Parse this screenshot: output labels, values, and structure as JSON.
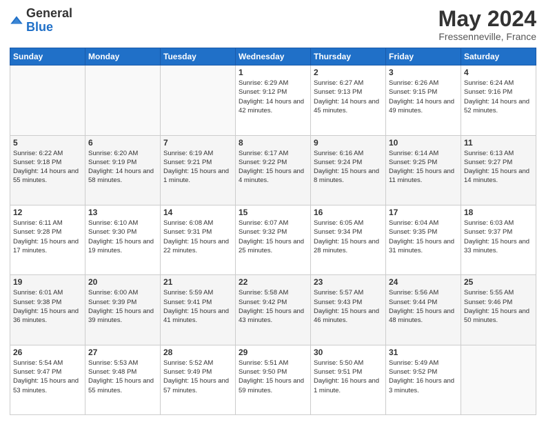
{
  "logo": {
    "general": "General",
    "blue": "Blue"
  },
  "header": {
    "month": "May 2024",
    "location": "Fressenneville, France"
  },
  "weekdays": [
    "Sunday",
    "Monday",
    "Tuesday",
    "Wednesday",
    "Thursday",
    "Friday",
    "Saturday"
  ],
  "weeks": [
    [
      {
        "day": "",
        "sunrise": "",
        "sunset": "",
        "daylight": ""
      },
      {
        "day": "",
        "sunrise": "",
        "sunset": "",
        "daylight": ""
      },
      {
        "day": "",
        "sunrise": "",
        "sunset": "",
        "daylight": ""
      },
      {
        "day": "1",
        "sunrise": "Sunrise: 6:29 AM",
        "sunset": "Sunset: 9:12 PM",
        "daylight": "Daylight: 14 hours and 42 minutes."
      },
      {
        "day": "2",
        "sunrise": "Sunrise: 6:27 AM",
        "sunset": "Sunset: 9:13 PM",
        "daylight": "Daylight: 14 hours and 45 minutes."
      },
      {
        "day": "3",
        "sunrise": "Sunrise: 6:26 AM",
        "sunset": "Sunset: 9:15 PM",
        "daylight": "Daylight: 14 hours and 49 minutes."
      },
      {
        "day": "4",
        "sunrise": "Sunrise: 6:24 AM",
        "sunset": "Sunset: 9:16 PM",
        "daylight": "Daylight: 14 hours and 52 minutes."
      }
    ],
    [
      {
        "day": "5",
        "sunrise": "Sunrise: 6:22 AM",
        "sunset": "Sunset: 9:18 PM",
        "daylight": "Daylight: 14 hours and 55 minutes."
      },
      {
        "day": "6",
        "sunrise": "Sunrise: 6:20 AM",
        "sunset": "Sunset: 9:19 PM",
        "daylight": "Daylight: 14 hours and 58 minutes."
      },
      {
        "day": "7",
        "sunrise": "Sunrise: 6:19 AM",
        "sunset": "Sunset: 9:21 PM",
        "daylight": "Daylight: 15 hours and 1 minute."
      },
      {
        "day": "8",
        "sunrise": "Sunrise: 6:17 AM",
        "sunset": "Sunset: 9:22 PM",
        "daylight": "Daylight: 15 hours and 4 minutes."
      },
      {
        "day": "9",
        "sunrise": "Sunrise: 6:16 AM",
        "sunset": "Sunset: 9:24 PM",
        "daylight": "Daylight: 15 hours and 8 minutes."
      },
      {
        "day": "10",
        "sunrise": "Sunrise: 6:14 AM",
        "sunset": "Sunset: 9:25 PM",
        "daylight": "Daylight: 15 hours and 11 minutes."
      },
      {
        "day": "11",
        "sunrise": "Sunrise: 6:13 AM",
        "sunset": "Sunset: 9:27 PM",
        "daylight": "Daylight: 15 hours and 14 minutes."
      }
    ],
    [
      {
        "day": "12",
        "sunrise": "Sunrise: 6:11 AM",
        "sunset": "Sunset: 9:28 PM",
        "daylight": "Daylight: 15 hours and 17 minutes."
      },
      {
        "day": "13",
        "sunrise": "Sunrise: 6:10 AM",
        "sunset": "Sunset: 9:30 PM",
        "daylight": "Daylight: 15 hours and 19 minutes."
      },
      {
        "day": "14",
        "sunrise": "Sunrise: 6:08 AM",
        "sunset": "Sunset: 9:31 PM",
        "daylight": "Daylight: 15 hours and 22 minutes."
      },
      {
        "day": "15",
        "sunrise": "Sunrise: 6:07 AM",
        "sunset": "Sunset: 9:32 PM",
        "daylight": "Daylight: 15 hours and 25 minutes."
      },
      {
        "day": "16",
        "sunrise": "Sunrise: 6:05 AM",
        "sunset": "Sunset: 9:34 PM",
        "daylight": "Daylight: 15 hours and 28 minutes."
      },
      {
        "day": "17",
        "sunrise": "Sunrise: 6:04 AM",
        "sunset": "Sunset: 9:35 PM",
        "daylight": "Daylight: 15 hours and 31 minutes."
      },
      {
        "day": "18",
        "sunrise": "Sunrise: 6:03 AM",
        "sunset": "Sunset: 9:37 PM",
        "daylight": "Daylight: 15 hours and 33 minutes."
      }
    ],
    [
      {
        "day": "19",
        "sunrise": "Sunrise: 6:01 AM",
        "sunset": "Sunset: 9:38 PM",
        "daylight": "Daylight: 15 hours and 36 minutes."
      },
      {
        "day": "20",
        "sunrise": "Sunrise: 6:00 AM",
        "sunset": "Sunset: 9:39 PM",
        "daylight": "Daylight: 15 hours and 39 minutes."
      },
      {
        "day": "21",
        "sunrise": "Sunrise: 5:59 AM",
        "sunset": "Sunset: 9:41 PM",
        "daylight": "Daylight: 15 hours and 41 minutes."
      },
      {
        "day": "22",
        "sunrise": "Sunrise: 5:58 AM",
        "sunset": "Sunset: 9:42 PM",
        "daylight": "Daylight: 15 hours and 43 minutes."
      },
      {
        "day": "23",
        "sunrise": "Sunrise: 5:57 AM",
        "sunset": "Sunset: 9:43 PM",
        "daylight": "Daylight: 15 hours and 46 minutes."
      },
      {
        "day": "24",
        "sunrise": "Sunrise: 5:56 AM",
        "sunset": "Sunset: 9:44 PM",
        "daylight": "Daylight: 15 hours and 48 minutes."
      },
      {
        "day": "25",
        "sunrise": "Sunrise: 5:55 AM",
        "sunset": "Sunset: 9:46 PM",
        "daylight": "Daylight: 15 hours and 50 minutes."
      }
    ],
    [
      {
        "day": "26",
        "sunrise": "Sunrise: 5:54 AM",
        "sunset": "Sunset: 9:47 PM",
        "daylight": "Daylight: 15 hours and 53 minutes."
      },
      {
        "day": "27",
        "sunrise": "Sunrise: 5:53 AM",
        "sunset": "Sunset: 9:48 PM",
        "daylight": "Daylight: 15 hours and 55 minutes."
      },
      {
        "day": "28",
        "sunrise": "Sunrise: 5:52 AM",
        "sunset": "Sunset: 9:49 PM",
        "daylight": "Daylight: 15 hours and 57 minutes."
      },
      {
        "day": "29",
        "sunrise": "Sunrise: 5:51 AM",
        "sunset": "Sunset: 9:50 PM",
        "daylight": "Daylight: 15 hours and 59 minutes."
      },
      {
        "day": "30",
        "sunrise": "Sunrise: 5:50 AM",
        "sunset": "Sunset: 9:51 PM",
        "daylight": "Daylight: 16 hours and 1 minute."
      },
      {
        "day": "31",
        "sunrise": "Sunrise: 5:49 AM",
        "sunset": "Sunset: 9:52 PM",
        "daylight": "Daylight: 16 hours and 3 minutes."
      },
      {
        "day": "",
        "sunrise": "",
        "sunset": "",
        "daylight": ""
      }
    ]
  ]
}
